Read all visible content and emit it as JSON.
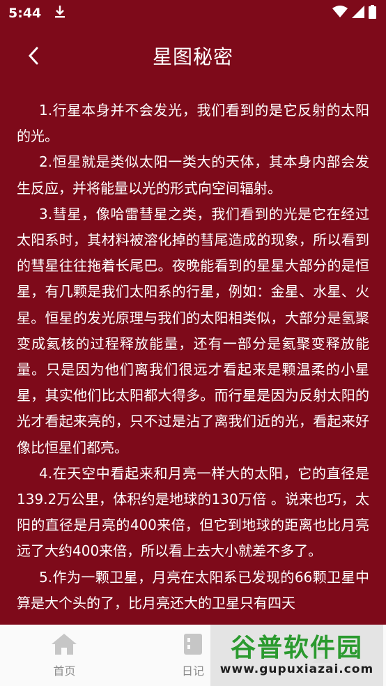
{
  "status_bar": {
    "time": "5:44"
  },
  "header": {
    "title": "星图秘密"
  },
  "article": {
    "paragraphs": [
      "1.行星本身并不会发光，我们看到的是它反射的太阳的光。",
      "2.恒星就是类似太阳一类大的天体，其本身内部会发生反应，并将能量以光的形式向空间辐射。",
      "3.彗星，像哈雷彗星之类，我们看到的光是它在经过太阳系时，其材料被溶化掉的彗尾造成的现象，所以看到的彗星往往拖着长尾巴。夜晚能看到的星星大部分的是恒星，有几颗是我们太阳系的行星，例如：金星、水星、火星。恒星的发光原理与我们的太阳相类似，大部分是氢聚变成氦核的过程释放能量，还有一部分是氦聚变释放能量。只是因为他们离我们很远才看起来是颗温柔的小星星，其实他们比太阳都大得多。而行星是因为反射太阳的光才看起来亮的，只不过是沾了离我们近的光，看起来好像比恒星们都亮。",
      "4.在天空中看起来和月亮一样大的太阳，它的直径是139.2万公里，体积约是地球的130万倍 。说来也巧，太阳的直径是月亮的400来倍，但它到地球的距离也比月亮远了大约400来倍，所以看上去大小就差不多了。",
      "5.作为一颗卫星，月亮在太阳系已发现的66颗卫星中算是大个头的了，比月亮还大的卫星只有四天"
    ]
  },
  "bottom_nav": {
    "items": [
      {
        "label": "首页",
        "icon": "home-icon"
      },
      {
        "label": "日记",
        "icon": "diary-icon"
      },
      {
        "label": "",
        "icon": "my-icon"
      }
    ]
  },
  "watermark": {
    "title": "谷普软件园",
    "url": "www.gupuxiazai.com"
  },
  "colors": {
    "background": "#7e0a1a",
    "nav_bg": "#fafafa",
    "nav_text": "#8c8c8c"
  }
}
